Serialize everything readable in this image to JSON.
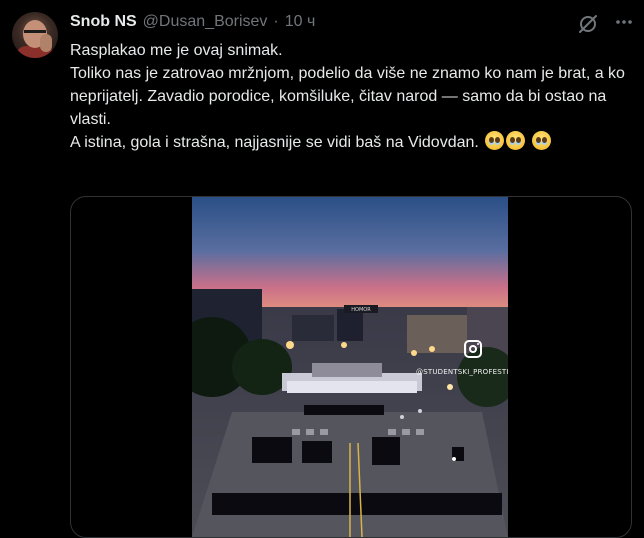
{
  "author": {
    "name": "Snob NS",
    "handle": "@Dusan_Borisev",
    "separator": "·",
    "time": "10 ч"
  },
  "icons": {
    "grok": "grok-icon",
    "more": "more-icon"
  },
  "tweet": {
    "line1": "Rasplakao me je ovaj snimak.",
    "line2": "Toliko nas je zatrovao mržnjom, podelio da više ne znamo ko nam je brat, a ko neprijatelj. Zavadio porodice, komšiluke, čitav narod — samo da bi ostao na vlasti.",
    "line3": "A istina, gola i strašna, najjasnije se vidi baš na Vidovdan."
  },
  "media": {
    "watermark": "@STUDENTSKI_PROFESTI",
    "sign_text": "HOMOR"
  },
  "colors": {
    "background": "#000000",
    "text": "#e7e9ea",
    "secondary": "#71767b",
    "border": "#2f3336"
  }
}
